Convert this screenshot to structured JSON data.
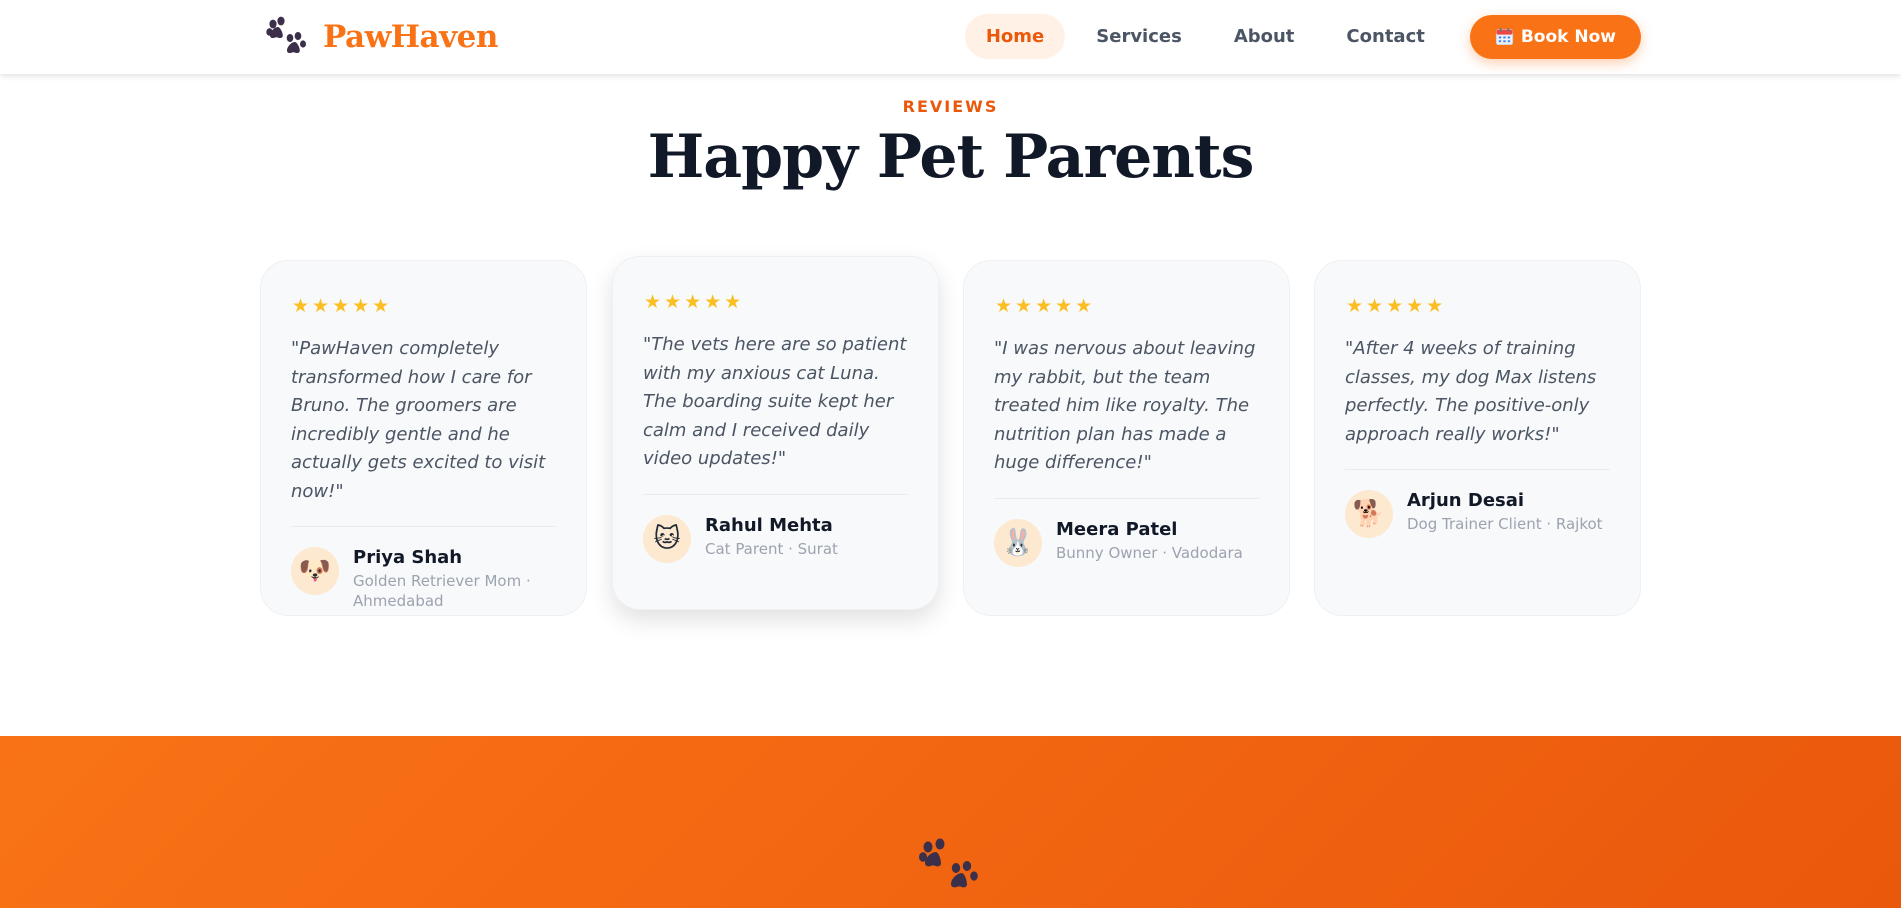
{
  "brand": {
    "name": "PawHaven",
    "icon": "paw-icon"
  },
  "nav": {
    "items": [
      {
        "label": "Home",
        "active": true
      },
      {
        "label": "Services",
        "active": false
      },
      {
        "label": "About",
        "active": false
      },
      {
        "label": "Contact",
        "active": false
      }
    ],
    "cta": {
      "label": "Book Now",
      "icon": "calendar-icon"
    }
  },
  "reviews": {
    "eyebrow": "REVIEWS",
    "title": "Happy Pet Parents",
    "cards": [
      {
        "stars": "★★★★★",
        "quote": "\"PawHaven completely transformed how I care for Bruno. The groomers are incredibly gentle and he actually gets excited to visit now!\"",
        "avatar": "🐶",
        "name": "Priya Shah",
        "meta": "Golden Retriever Mom · Ahmedabad"
      },
      {
        "stars": "★★★★★",
        "quote": "\"The vets here are so patient with my anxious cat Luna. The boarding suite kept her calm and I received daily video updates!\"",
        "avatar": "🐱",
        "name": "Rahul Mehta",
        "meta": "Cat Parent · Surat"
      },
      {
        "stars": "★★★★★",
        "quote": "\"I was nervous about leaving my rabbit, but the team treated him like royalty. The nutrition plan has made a huge difference!\"",
        "avatar": "🐰",
        "name": "Meera Patel",
        "meta": "Bunny Owner · Vadodara"
      },
      {
        "stars": "★★★★★",
        "quote": "\"After 4 weeks of training classes, my dog Max listens perfectly. The positive-only approach really works!\"",
        "avatar": "🐕",
        "name": "Arjun Desai",
        "meta": "Dog Trainer Client · Rajkot"
      }
    ]
  },
  "colors": {
    "accent": "#f97316",
    "accent_dark": "#ea580c",
    "star": "#fbbf24",
    "title": "#111827"
  }
}
